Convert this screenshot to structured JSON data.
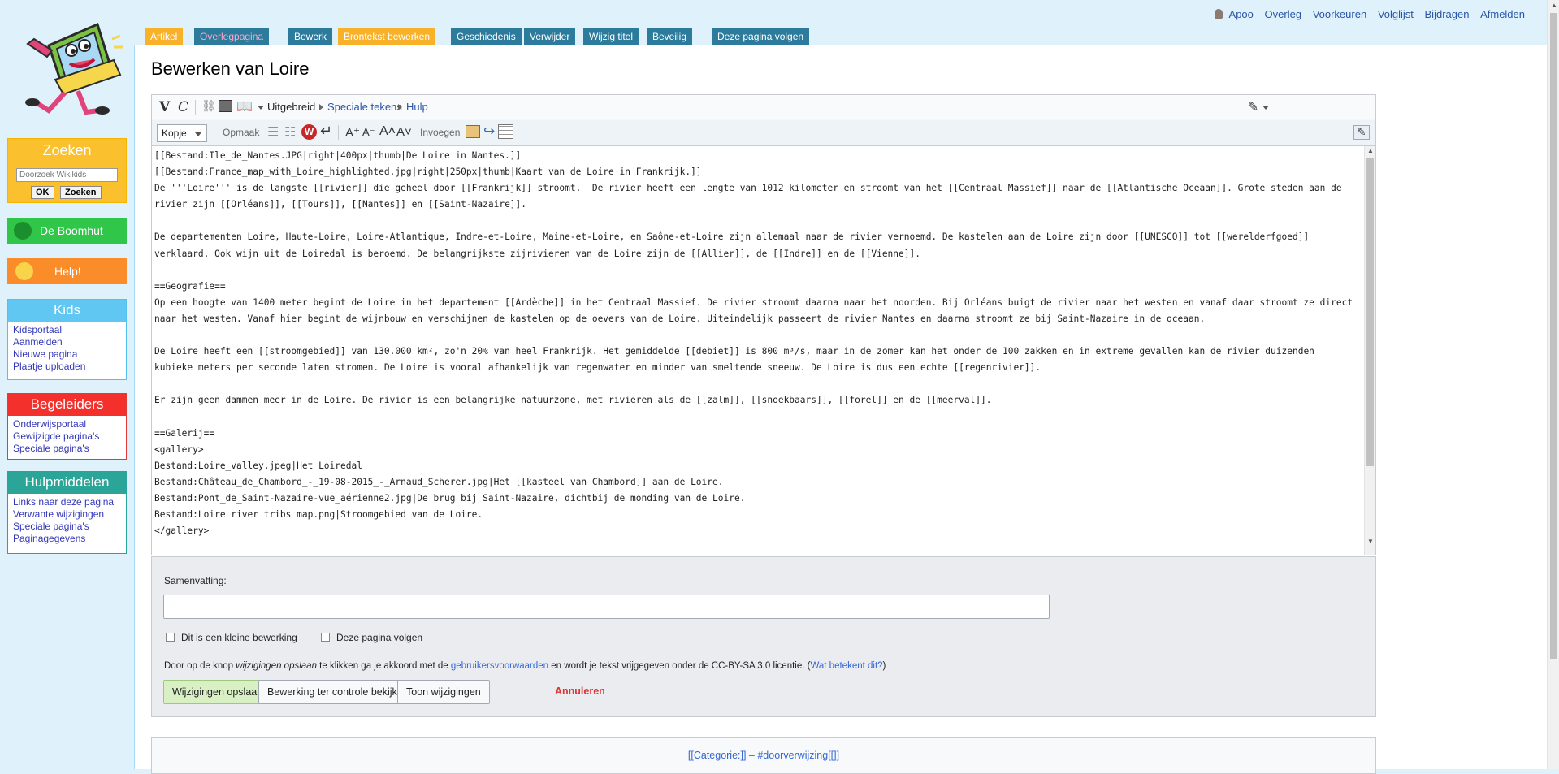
{
  "sidebar": {
    "search": {
      "title": "Zoeken",
      "placeholder": "Doorzoek Wikikids",
      "ok_label": "OK",
      "search_label": "Zoeken"
    },
    "boomhut_label": "De Boomhut",
    "help_label": "Help!",
    "kids": {
      "title": "Kids",
      "links": [
        "Kidsportaal",
        "Aanmelden",
        "Nieuwe pagina",
        "Plaatje uploaden"
      ]
    },
    "begeleiders": {
      "title": "Begeleiders",
      "links": [
        "Onderwijsportaal",
        "Gewijzigde pagina's",
        "Speciale pagina's"
      ]
    },
    "hulpmiddelen": {
      "title": "Hulpmiddelen",
      "links": [
        "Links naar deze pagina",
        "Verwante wijzigingen",
        "Speciale pagina's",
        "Paginagegevens"
      ]
    }
  },
  "personal": [
    "Apoo",
    "Overleg",
    "Voorkeuren",
    "Volglijst",
    "Bijdragen",
    "Afmelden"
  ],
  "tabs": [
    "Artikel",
    "Overlegpagina",
    "Bewerk",
    "Brontekst bewerken",
    "Geschiedenis",
    "Verwijder",
    "Wijzig titel",
    "Beveilig",
    "Deze pagina volgen"
  ],
  "page_title": "Bewerken van Loire",
  "toolbar": {
    "bold": "V",
    "italic": "C",
    "advanced": "Uitgebreid",
    "special_chars": "Speciale tekens",
    "help": "Hulp",
    "heading_select": "Kopje",
    "format": "Opmaak",
    "insert": "Invoegen"
  },
  "editor_text": "[[Bestand:Ile_de_Nantes.JPG|right|400px|thumb|De Loire in Nantes.]]\n[[Bestand:France_map_with_Loire_highlighted.jpg|right|250px|thumb|Kaart van de Loire in Frankrijk.]]\nDe '''Loire''' is de langste [[rivier]] die geheel door [[Frankrijk]] stroomt.  De rivier heeft een lengte van 1012 kilometer en stroomt van het [[Centraal Massief]] naar de [[Atlantische Oceaan]]. Grote steden aan de rivier zijn [[Orléans]], [[Tours]], [[Nantes]] en [[Saint-Nazaire]].\n\nDe departementen Loire, Haute-Loire, Loire-Atlantique, Indre-et-Loire, Maine-et-Loire, en Saône-et-Loire zijn allemaal naar de rivier vernoemd. De kastelen aan de Loire zijn door [[UNESCO]] tot [[werelderfgoed]] verklaard. Ook wijn uit de Loiredal is beroemd. De belangrijkste zijrivieren van de Loire zijn de [[Allier]], de [[Indre]] en de [[Vienne]].\n\n==Geografie==\nOp een hoogte van 1400 meter begint de Loire in het departement [[Ardèche]] in het Centraal Massief. De rivier stroomt daarna naar het noorden. Bij Orléans buigt de rivier naar het westen en vanaf daar stroomt ze direct naar het westen. Vanaf hier begint de wijnbouw en verschijnen de kastelen op de oevers van de Loire. Uiteindelijk passeert de rivier Nantes en daarna stroomt ze bij Saint-Nazaire in de oceaan.\n\nDe Loire heeft een [[stroomgebied]] van 130.000 km², zo'n 20% van heel Frankrijk. Het gemiddelde [[debiet]] is 800 m³/s, maar in de zomer kan het onder de 100 zakken en in extreme gevallen kan de rivier duizenden kubieke meters per seconde laten stromen. De Loire is vooral afhankelijk van regenwater en minder van smeltende sneeuw. De Loire is dus een echte [[regenrivier]].\n\nEr zijn geen dammen meer in de Loire. De rivier is een belangrijke natuurzone, met rivieren als de [[zalm]], [[snoekbaars]], [[forel]] en de [[meerval]].\n\n==Galerij==\n<gallery>\nBestand:Loire_valley.jpeg|Het Loiredal\nBestand:Château_de_Chambord_-_19-08-2015_-_Arnaud_Scherer.jpg|Het [[kasteel van Chambord]] aan de Loire.\nBestand:Pont_de_Saint-Nazaire-vue_aérienne2.jpg|De brug bij Saint-Nazaire, dichtbij de monding van de Loire.\nBestand:Loire river tribs map.png|Stroomgebied van de Loire.\n</gallery>",
  "save": {
    "summary_label": "Samenvatting:",
    "minor_label": "Dit is een kleine bewerking",
    "watch_label": "Deze pagina volgen",
    "terms_pre": "Door op de knop ",
    "terms_em": "wijzigingen opslaan",
    "terms_mid": " te klikken ga je akkoord met de ",
    "terms_link": "gebruikersvoorwaarden",
    "terms_post": " en wordt je tekst vrijgegeven onder de CC-BY-SA 3.0 licentie. (",
    "terms_link2": "Wat betekent dit?",
    "terms_end": ")",
    "save_button": "Wijzigingen opslaan",
    "preview_button": "Bewerking ter controle bekijken",
    "diff_button": "Toon wijzigingen",
    "cancel": "Annuleren"
  },
  "category_line": "[[Categorie:]] – #doorverwijzing[[]]"
}
